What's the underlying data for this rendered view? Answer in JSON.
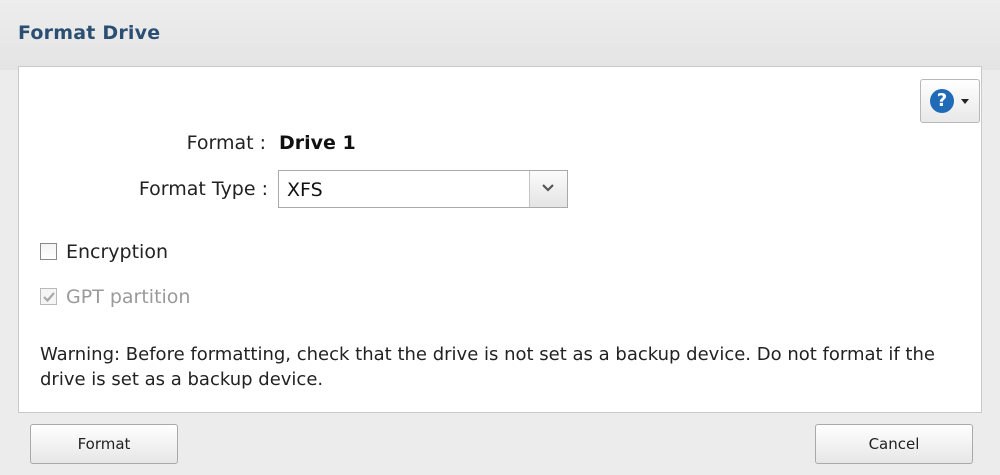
{
  "dialog": {
    "title": "Format Drive"
  },
  "help": {
    "icon": "question-circle-icon",
    "glyph": "?"
  },
  "form": {
    "format_label": "Format :",
    "format_value": "Drive 1",
    "format_type_label": "Format Type :",
    "format_type_value": "XFS",
    "format_type_options": [
      "XFS"
    ]
  },
  "options": {
    "encryption": {
      "label": "Encryption",
      "checked": false,
      "disabled": false
    },
    "gpt_partition": {
      "label": "GPT partition",
      "checked": true,
      "disabled": true
    }
  },
  "warning": "Warning: Before formatting, check that the drive is not set as a backup device. Do not format if the drive is set as a backup device.",
  "buttons": {
    "format": "Format",
    "cancel": "Cancel"
  },
  "colors": {
    "title": "#2a4f73",
    "help_icon": "#1f6bb8",
    "disabled_text": "#9a9a9a"
  }
}
